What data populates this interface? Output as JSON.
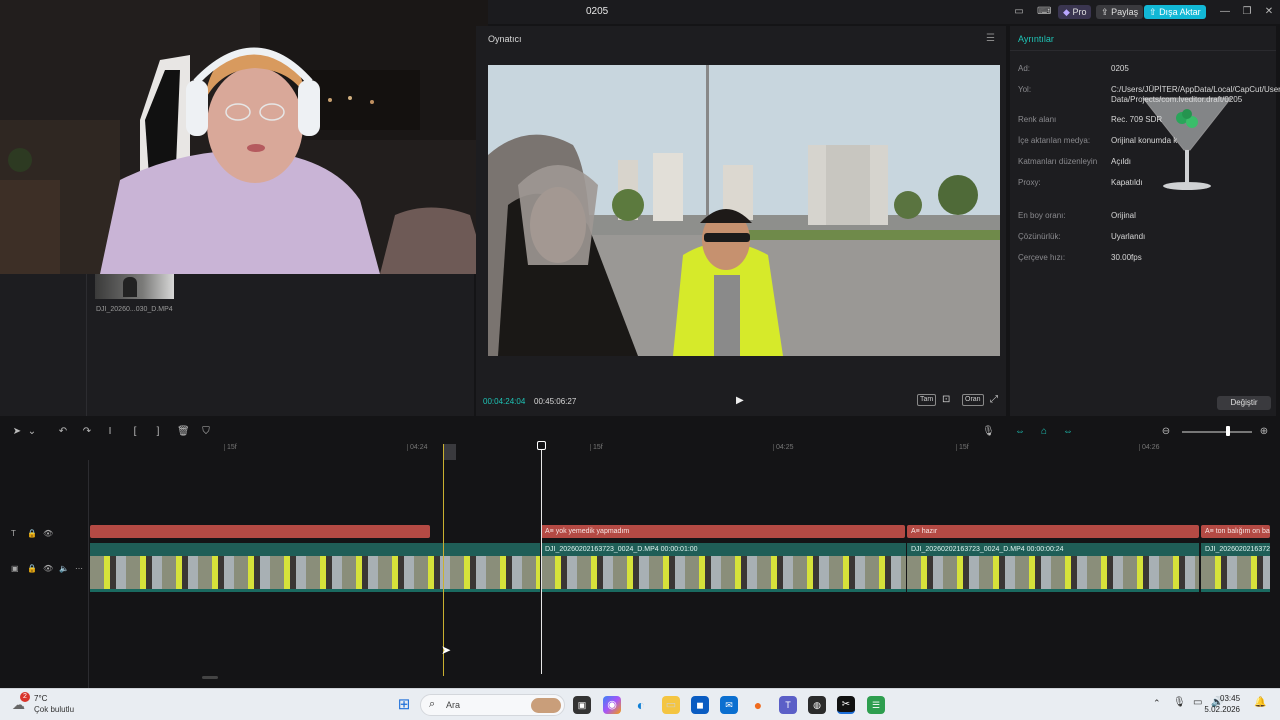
{
  "window": {
    "title": "0205"
  },
  "titlebar": {
    "pro_label": "Pro",
    "share_label": "Paylaş",
    "export_label": "Dışa Aktar",
    "minimize_glyph": "—",
    "maximize_glyph": "❐",
    "close_glyph": "✕"
  },
  "media": {
    "clip_name": "DJI_20260...030_D.MP4"
  },
  "player": {
    "title": "Oynatıcı",
    "current_time": "00:04:24:04",
    "total_time": "00:45:06:27",
    "full_label": "Tam",
    "ratio_label": "Oran"
  },
  "details": {
    "title": "Ayrıntılar",
    "rows": [
      {
        "label": "Ad:",
        "value": "0205"
      },
      {
        "label": "Yol:",
        "value": "C:/Users/JÜPİTER/AppData/Local/CapCut/User Data/Projects/com.lveditor.draft/0205"
      },
      {
        "label": "Renk alanı",
        "value": "Rec. 709 SDR"
      },
      {
        "label": "İçe aktarılan medya:",
        "value": "Orijinal konumda k"
      },
      {
        "label": "Katmanları düzenleyin",
        "value": "Açıldı"
      },
      {
        "label": "Proxy:",
        "value": "Kapatıldı"
      },
      {
        "label": "En boy oranı:",
        "value": "Orijinal"
      },
      {
        "label": "Çözünürlük:",
        "value": "Uyarlandı"
      },
      {
        "label": "Çerçeve hızı:",
        "value": "30.00fps"
      }
    ],
    "change_label": "Değiştir"
  },
  "timeline": {
    "ruler": [
      {
        "label": "15f"
      },
      {
        "label": "04:24"
      },
      {
        "label": "15f"
      },
      {
        "label": "04:25"
      },
      {
        "label": "15f"
      },
      {
        "label": "04:26"
      }
    ],
    "text_clips": [
      {
        "label": ""
      },
      {
        "label": "A≡ yok yemedik yapmadım"
      },
      {
        "label": "A≡ hazır"
      },
      {
        "label": "A≡ ton balığım on ba"
      }
    ],
    "video_clips": [
      {
        "label": ""
      },
      {
        "label": "DJI_20260202163723_0024_D.MP4   00:00:01:00"
      },
      {
        "label": "DJI_20260202163723_0024_D.MP4   00:00:00:24"
      },
      {
        "label": "DJI_2026020216372"
      }
    ]
  },
  "taskbar": {
    "weather_temp": "7°C",
    "weather_desc": "Çok bulutlu",
    "weather_badge": "2",
    "search_label": "Ara",
    "time": "03:45",
    "date": "5.02.2026"
  }
}
